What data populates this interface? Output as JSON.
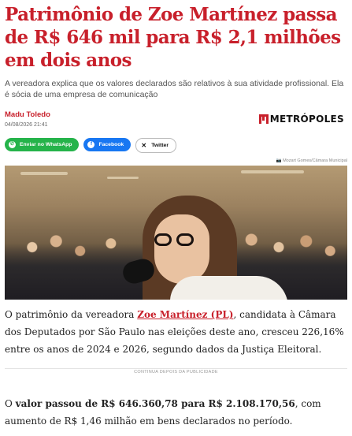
{
  "article": {
    "headline": "Patrimônio de Zoe Martínez passa de R$ 646 mil para R$ 2,1 milhões em dois anos",
    "subtitle": "A vereadora explica que os valores declarados são relativos à sua atividade profissional. Ela é sócia de uma empresa de comunicação",
    "author": "Madu Toledo",
    "date": "04/08/2026 21:41",
    "brand": "METRÓPOLES",
    "share": {
      "whatsapp": "Enviar no WhatsApp",
      "facebook": "Facebook",
      "twitter": "Twitter"
    },
    "photo_credit": "Mozart Gomes/Câmara Municipal",
    "p1": {
      "before": "O patrimônio da vereadora ",
      "link": "Zoe Martínez (PL)",
      "after": ", candidata à Câmara dos Deputados por São Paulo nas eleições deste ano, cresceu 226,16% entre os anos de 2024 e 2026, segundo dados da Justiça Eleitoral."
    },
    "ad_label": "CONTINUA DEPOIS DA PUBLICIDADE",
    "p2": {
      "before": "O ",
      "bold": "valor passou de R$ 646.360,78 para R$ 2.108.170,56",
      "after": ", com aumento de R$ 1,46 milhão em bens declarados no período."
    }
  },
  "icons": {
    "whatsapp": "whatsapp-icon",
    "facebook": "facebook-icon",
    "twitter": "x-icon",
    "camera": "camera-icon"
  },
  "colors": {
    "accent": "#c8202b",
    "whatsapp": "#25b34a",
    "facebook": "#1877f2"
  }
}
